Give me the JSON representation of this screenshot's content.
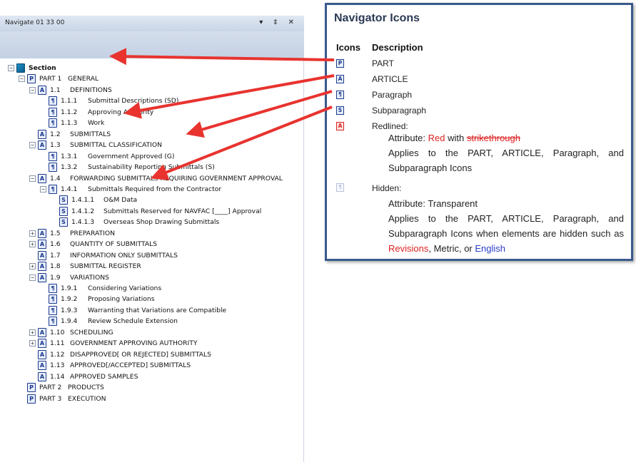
{
  "panel": {
    "title": "Navigate 01 33 00",
    "controls": "▾ ‡ ✕"
  },
  "tree": [
    {
      "num": "",
      "label": "Section",
      "icon": "section-icon",
      "glyph": "",
      "exp": "−",
      "bold": true
    },
    {
      "num": "PART 1",
      "label": "GENERAL",
      "icon": "part-icon",
      "glyph": "P",
      "exp": "−"
    },
    {
      "num": "1.1",
      "label": "DEFINITIONS",
      "icon": "article-icon",
      "glyph": "A",
      "exp": "−"
    },
    {
      "num": "1.1.1",
      "label": "Submittal Descriptions (SD)",
      "icon": "paragraph-icon",
      "glyph": "¶",
      "exp": ""
    },
    {
      "num": "1.1.2",
      "label": "Approving Authority",
      "icon": "paragraph-icon",
      "glyph": "¶",
      "exp": ""
    },
    {
      "num": "1.1.3",
      "label": "Work",
      "icon": "paragraph-icon",
      "glyph": "¶",
      "exp": ""
    },
    {
      "num": "1.2",
      "label": "SUBMITTALS",
      "icon": "article-icon",
      "glyph": "A",
      "exp": ""
    },
    {
      "num": "1.3",
      "label": "SUBMITTAL CLASSIFICATION",
      "icon": "article-icon",
      "glyph": "A",
      "exp": "−"
    },
    {
      "num": "1.3.1",
      "label": "Government Approved (G)",
      "icon": "paragraph-icon",
      "glyph": "¶",
      "exp": ""
    },
    {
      "num": "1.3.2",
      "label": "Sustainability Reporting Submittals (S)",
      "icon": "paragraph-icon",
      "glyph": "¶",
      "exp": ""
    },
    {
      "num": "1.4",
      "label": "FORWARDING SUBMITTALS REQUIRING GOVERNMENT APPROVAL",
      "icon": "article-icon",
      "glyph": "A",
      "exp": "−"
    },
    {
      "num": "1.4.1",
      "label": "Submittals Required from the Contractor",
      "icon": "paragraph-icon",
      "glyph": "¶",
      "exp": "−"
    },
    {
      "num": "1.4.1.1",
      "label": "O&M Data",
      "icon": "subparagraph-icon",
      "glyph": "S",
      "exp": ""
    },
    {
      "num": "1.4.1.2",
      "label": "Submittals Reserved for NAVFAC [____] Approval",
      "icon": "subparagraph-icon",
      "glyph": "S",
      "exp": ""
    },
    {
      "num": "1.4.1.3",
      "label": "Overseas Shop Drawing Submittals",
      "icon": "subparagraph-icon",
      "glyph": "S",
      "exp": ""
    },
    {
      "num": "1.5",
      "label": "PREPARATION",
      "icon": "article-icon",
      "glyph": "A",
      "exp": "+"
    },
    {
      "num": "1.6",
      "label": "QUANTITY OF SUBMITTALS",
      "icon": "article-icon",
      "glyph": "A",
      "exp": "+"
    },
    {
      "num": "1.7",
      "label": "INFORMATION ONLY SUBMITTALS",
      "icon": "article-icon",
      "glyph": "A",
      "exp": ""
    },
    {
      "num": "1.8",
      "label": "SUBMITTAL REGISTER",
      "icon": "article-icon",
      "glyph": "A",
      "exp": "+"
    },
    {
      "num": "1.9",
      "label": "VARIATIONS",
      "icon": "article-icon",
      "glyph": "A",
      "exp": "−"
    },
    {
      "num": "1.9.1",
      "label": "Considering Variations",
      "icon": "paragraph-icon",
      "glyph": "¶",
      "exp": ""
    },
    {
      "num": "1.9.2",
      "label": "Proposing Variations",
      "icon": "paragraph-icon",
      "glyph": "¶",
      "exp": ""
    },
    {
      "num": "1.9.3",
      "label": "Warranting that Variations are Compatible",
      "icon": "paragraph-icon",
      "glyph": "¶",
      "exp": ""
    },
    {
      "num": "1.9.4",
      "label": "Review Schedule Extension",
      "icon": "paragraph-icon",
      "glyph": "¶",
      "exp": ""
    },
    {
      "num": "1.10",
      "label": "SCHEDULING",
      "icon": "article-icon",
      "glyph": "A",
      "exp": "+"
    },
    {
      "num": "1.11",
      "label": "GOVERNMENT APPROVING AUTHORITY",
      "icon": "article-icon",
      "glyph": "A",
      "exp": "+"
    },
    {
      "num": "1.12",
      "label": "DISAPPROVED[ OR REJECTED] SUBMITTALS",
      "icon": "article-icon",
      "glyph": "A",
      "exp": ""
    },
    {
      "num": "1.13",
      "label": "APPROVED[/ACCEPTED] SUBMITTALS",
      "icon": "article-icon",
      "glyph": "A",
      "exp": ""
    },
    {
      "num": "1.14",
      "label": "APPROVED SAMPLES",
      "icon": "article-icon",
      "glyph": "A",
      "exp": ""
    },
    {
      "num": "PART 2",
      "label": "PRODUCTS",
      "icon": "part-icon",
      "glyph": "P",
      "exp": ""
    },
    {
      "num": "PART 3",
      "label": "EXECUTION",
      "icon": "part-icon",
      "glyph": "P",
      "exp": ""
    }
  ],
  "legend": {
    "title": "Navigator Icons",
    "col_icons": "Icons",
    "col_desc": "Description",
    "items": [
      {
        "glyph": "P",
        "icon": "part-icon",
        "label": "PART"
      },
      {
        "glyph": "A",
        "icon": "article-icon",
        "label": "ARTICLE"
      },
      {
        "glyph": "¶",
        "icon": "paragraph-icon",
        "label": "Paragraph"
      },
      {
        "glyph": "S",
        "icon": "subparagraph-icon",
        "label": "Subparagraph"
      },
      {
        "glyph": "A",
        "icon": "redlined-icon",
        "label": "Redlined:"
      }
    ],
    "redlined": {
      "attr_prefix": "Attribute: ",
      "attr_red": "Red",
      "attr_with": " with ",
      "attr_strike": "strikethrough",
      "applies": "Applies to the PART, ARTICLE, Paragraph, and Subparagraph Icons"
    },
    "hidden": {
      "glyph": "¶",
      "label": "Hidden:",
      "attr": "Attribute: Transparent",
      "applies": "Applies to the PART, ARTICLE, Paragraph, and Subparagraph Icons when elements are hidden such as ",
      "revisions": "Revisions",
      "comma": ", Metric, or ",
      "english": "English"
    }
  },
  "colors": {
    "arrow": "#e8332f",
    "icon_blue": "#1b3a8c",
    "legend_border": "#3a5a8c"
  }
}
